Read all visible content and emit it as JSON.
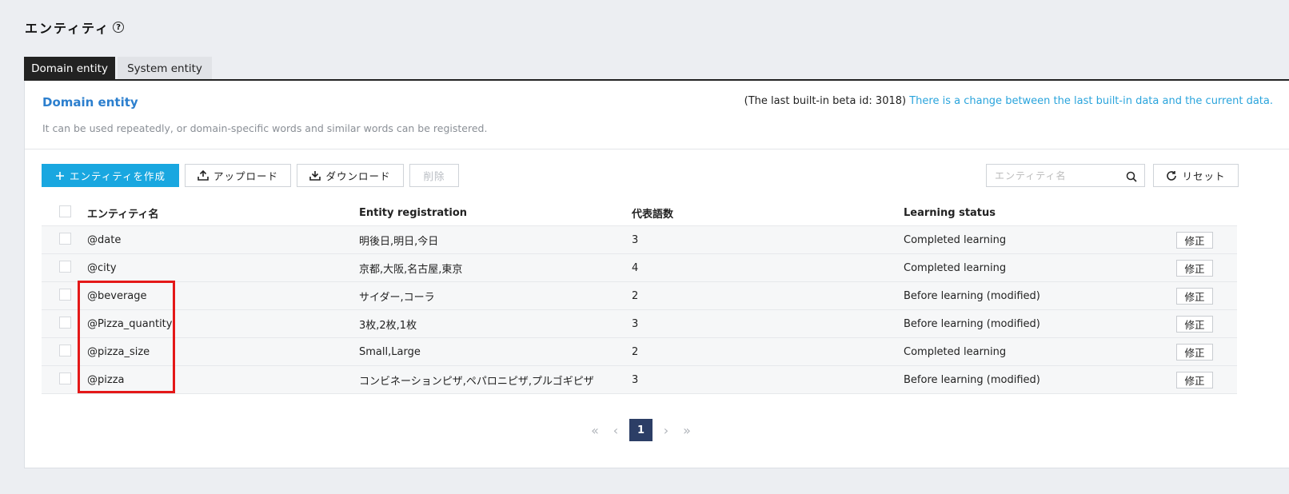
{
  "page": {
    "title": "エンティティ",
    "help_icon": "?"
  },
  "tabs": [
    {
      "label": "Domain entity",
      "active": true
    },
    {
      "label": "System entity",
      "active": false
    }
  ],
  "section": {
    "title": "Domain entity",
    "build_info_prefix": "(The last built-in beta id: 3018)",
    "build_info_link": "There is a change between the last built-in data and the current data.",
    "description": "It can be used repeatedly, or domain-specific words and similar words can be registered."
  },
  "toolbar": {
    "create_label": "エンティティを作成",
    "upload_label": "アップロード",
    "download_label": "ダウンロード",
    "delete_label": "削除",
    "search_placeholder": "エンティティ名",
    "reset_label": "リセット"
  },
  "table": {
    "headers": [
      "エンティティ名",
      "Entity registration",
      "代表語数",
      "Learning status"
    ],
    "edit_label": "修正",
    "rows": [
      {
        "name": "@date",
        "registration": "明後日,明日,今日",
        "count": "3",
        "status": "Completed learning"
      },
      {
        "name": "@city",
        "registration": "京都,大阪,名古屋,東京",
        "count": "4",
        "status": "Completed learning"
      },
      {
        "name": "@beverage",
        "registration": "サイダー,コーラ",
        "count": "2",
        "status": "Before learning (modified)"
      },
      {
        "name": "@Pizza_quantity",
        "registration": "3枚,2枚,1枚",
        "count": "3",
        "status": "Before learning (modified)"
      },
      {
        "name": "@pizza_size",
        "registration": "Small,Large",
        "count": "2",
        "status": "Completed learning"
      },
      {
        "name": "@pizza",
        "registration": "コンビネーションピザ,ペパロニピザ,プルゴギピザ",
        "count": "3",
        "status": "Before learning (modified)"
      }
    ]
  },
  "pagination": {
    "current": "1"
  },
  "colors": {
    "accent": "#19a7e0",
    "link": "#2aa4dc",
    "title": "#2c7fce",
    "highlight": "#e41818",
    "pager": "#2c3e66"
  }
}
